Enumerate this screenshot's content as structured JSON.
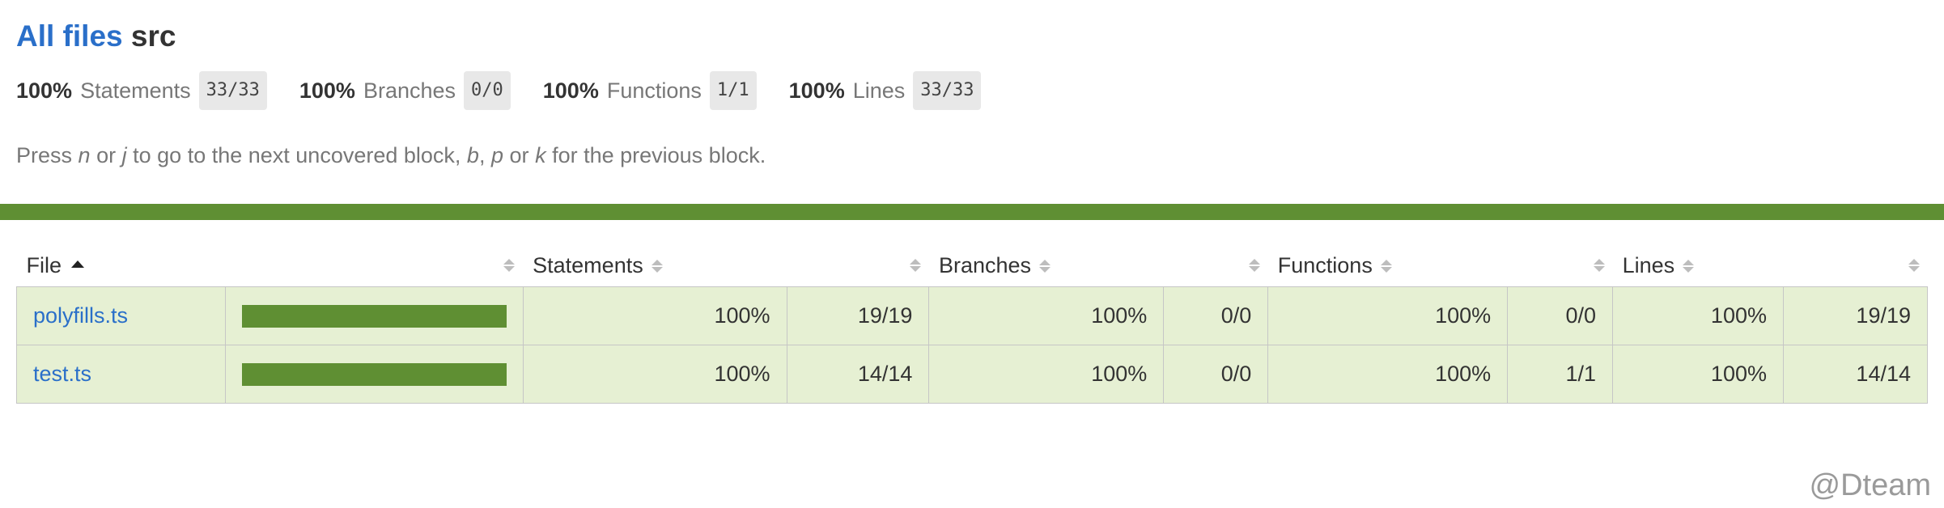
{
  "header": {
    "all_files_link": "All files",
    "current_dir": "src"
  },
  "summary": [
    {
      "pct": "100%",
      "label": "Statements",
      "fraction": "33/33"
    },
    {
      "pct": "100%",
      "label": "Branches",
      "fraction": "0/0"
    },
    {
      "pct": "100%",
      "label": "Functions",
      "fraction": "1/1"
    },
    {
      "pct": "100%",
      "label": "Lines",
      "fraction": "33/33"
    }
  ],
  "hint": {
    "press": "Press",
    "n": "n",
    "or1": "or",
    "j": "j",
    "middle": "to go to the next uncovered block,",
    "b": "b",
    "comma": ",",
    "p": "p",
    "or2": "or",
    "k": "k",
    "end": "for the previous block."
  },
  "colors": {
    "accent": "#5f8f33",
    "row_bg": "#e6f0d3",
    "link": "#2a6fc9"
  },
  "table": {
    "headers": {
      "file": "File",
      "statements": "Statements",
      "branches": "Branches",
      "functions": "Functions",
      "lines": "Lines"
    },
    "rows": [
      {
        "file": "polyfills.ts",
        "coverage_fill": 1.0,
        "statements_pct": "100%",
        "statements_frac": "19/19",
        "branches_pct": "100%",
        "branches_frac": "0/0",
        "functions_pct": "100%",
        "functions_frac": "0/0",
        "lines_pct": "100%",
        "lines_frac": "19/19"
      },
      {
        "file": "test.ts",
        "coverage_fill": 1.0,
        "statements_pct": "100%",
        "statements_frac": "14/14",
        "branches_pct": "100%",
        "branches_frac": "0/0",
        "functions_pct": "100%",
        "functions_frac": "1/1",
        "lines_pct": "100%",
        "lines_frac": "14/14"
      }
    ]
  },
  "watermark": "@Dteam"
}
